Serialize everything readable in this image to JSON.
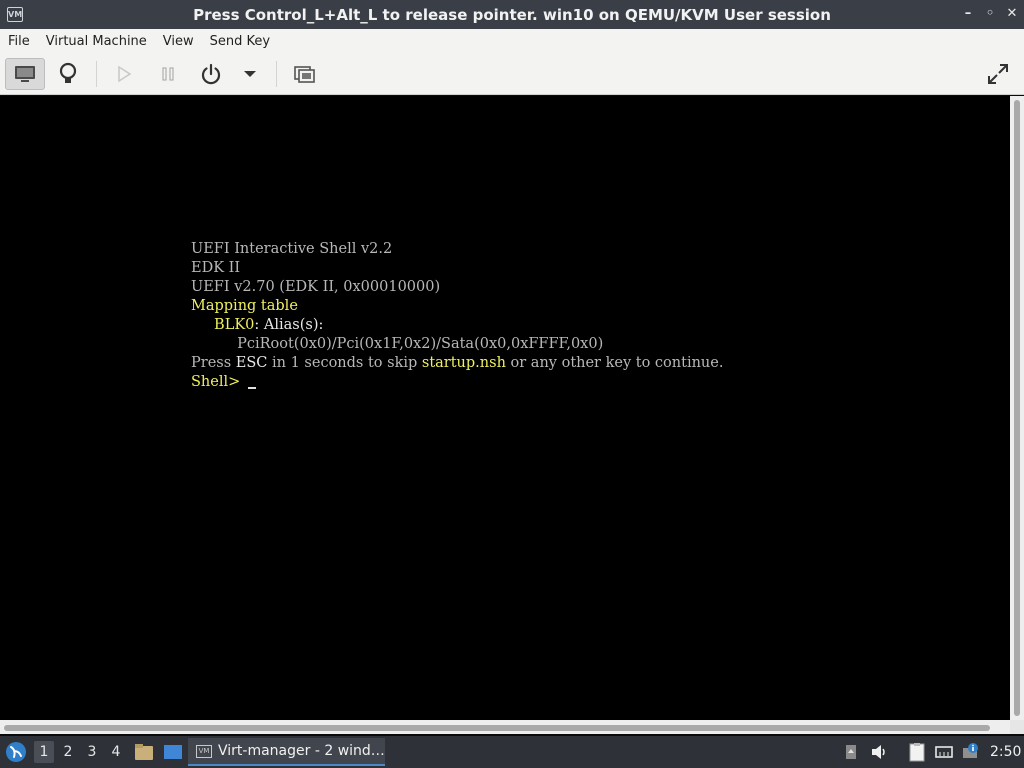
{
  "window": {
    "title": "Press Control_L+Alt_L to release pointer. win10 on QEMU/KVM User session",
    "app_icon_text": "VM"
  },
  "menu": {
    "items": [
      "File",
      "Virtual Machine",
      "View",
      "Send Key"
    ]
  },
  "console": {
    "lines": [
      "UEFI Interactive Shell v2.2",
      "EDK II",
      "UEFI v2.70 (EDK II, 0x00010000)",
      "Mapping table",
      "     BLK0",
      ": Alias(s):",
      "          PciRoot(0x0)/Pci(0x1F,0x2)/Sata(0x0,0xFFFF,0x0)",
      "Press ",
      "ESC",
      " in 1 seconds to skip ",
      "startup.nsh",
      " or any other key to continue.",
      "Shell> "
    ]
  },
  "taskbar": {
    "workspaces": [
      "1",
      "2",
      "3",
      "4"
    ],
    "active_workspace": "1",
    "task_label": "Virt-manager - 2 wind…",
    "clock": "2:50"
  },
  "colors": {
    "titlebar": "#3a3f47",
    "console_bg": "#000000",
    "console_text": "#b8b8b8",
    "console_highlight": "#f0f060",
    "taskbar": "#2e3238",
    "accent": "#4c88c8"
  }
}
